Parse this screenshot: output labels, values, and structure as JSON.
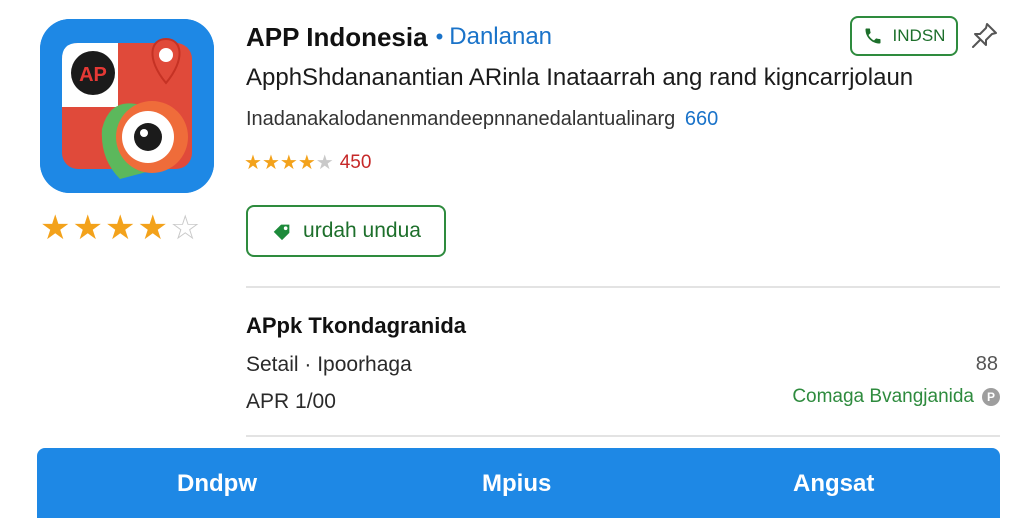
{
  "app": {
    "title": "APP Indonesia",
    "developer": "Danlanan",
    "tagline": "ApphShdananantian ARinla Inataarrah ang rand kigncarrjolaun",
    "description": "Inadanakalodanenmandeepnnanedalantualinarg",
    "description_count": "660",
    "rating_value": "450",
    "rating_stars": 4.5,
    "icon_badge_text": "AP"
  },
  "header": {
    "contact_label": "INDSN"
  },
  "download": {
    "label": "urdah undua"
  },
  "details": {
    "section_title": "APpk Tkondagranida",
    "row1_label": "Setail · Ipoorhaga",
    "row1_value": "88",
    "row2_label": "APR 1/00",
    "company_link": "Comaga Bvangjanida"
  },
  "bottom_nav": {
    "items": [
      "Dndpw",
      "Mpius",
      "Angsat"
    ]
  },
  "colors": {
    "accent_blue": "#1e88e5",
    "accent_green": "#2e8b3e",
    "star": "#f3a21b",
    "rating_red": "#c62828"
  },
  "icons": [
    "phone-icon",
    "pin-icon",
    "download-tag-icon",
    "info-icon",
    "person-icon"
  ]
}
